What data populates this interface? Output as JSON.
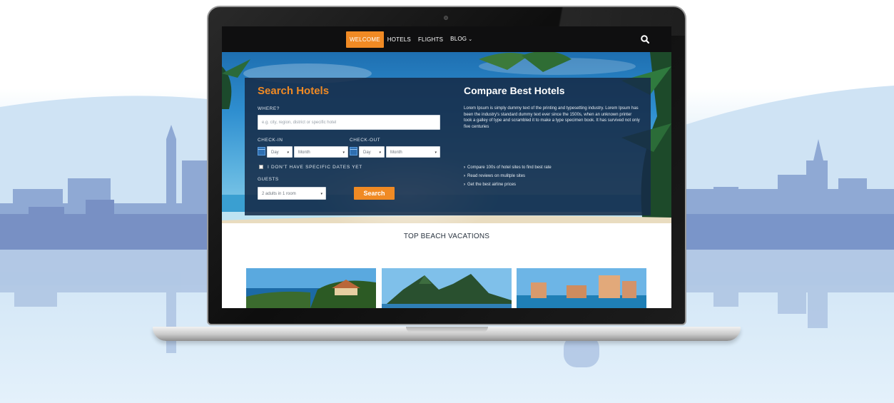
{
  "nav": {
    "items": [
      {
        "label": "WELCOME",
        "active": true
      },
      {
        "label": "HOTELS",
        "active": false
      },
      {
        "label": "FLIGHTS",
        "active": false
      },
      {
        "label": "BLOG",
        "active": false,
        "has_dropdown": true
      }
    ],
    "search_icon": "search-icon"
  },
  "search_form": {
    "title": "Search Hotels",
    "where_label": "WHERE?",
    "where_placeholder": "e.g. city, region, district or specific hotel",
    "checkin_label": "CHECK-IN",
    "checkout_label": "CHECK-OUT",
    "checkin_day": "Day",
    "checkin_month": "Month",
    "checkout_day": "Day",
    "checkout_month": "Month",
    "no_dates_label": "I DON'T HAVE SPECIFIC DATES YET",
    "guests_label": "GUESTS",
    "guests_value": "2 adults in 1 room",
    "search_button": "Search"
  },
  "compare": {
    "title": "Compare Best Hotels",
    "body": "Lorem Ipsum is simply dummy text of the printing and typesetting industry. Lorem Ipsum has been the industry's standard dummy text ever since the 1500s, when an unknown printer took a galley of type and scrambled it to make a type specimen book. It has survived not only five centuries",
    "features": [
      "Compare 100s of hotel sites to find best rate",
      "Read reviews on mulitple sites",
      "Get the best airline prices"
    ]
  },
  "vacations": {
    "title": "TOP BEACH VACATIONS"
  },
  "colors": {
    "accent": "#f08a24",
    "panel": "#162b48",
    "nav_bg": "#0f0f10"
  }
}
